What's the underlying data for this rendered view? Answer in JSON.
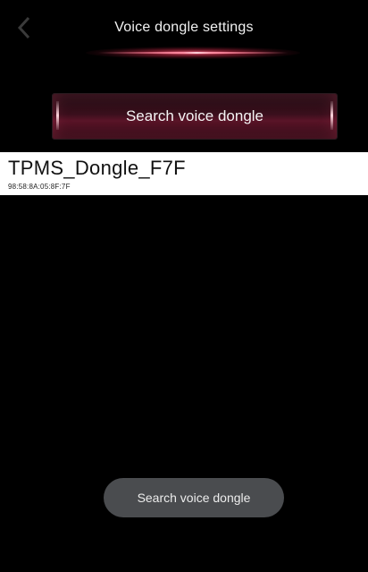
{
  "header": {
    "title": "Voice dongle settings",
    "back_icon": "chevron-left-icon"
  },
  "search_button": {
    "label": "Search voice dongle"
  },
  "devices": [
    {
      "name": "TPMS_Dongle_F7F",
      "address": "98:58:8A:05:8F:7F"
    }
  ],
  "toast": {
    "message": "Search voice dongle"
  },
  "colors": {
    "background": "#000000",
    "accent_glow": "#ff5a7a",
    "list_item_bg": "#ffffff",
    "toast_bg": "#4a4c4f"
  }
}
